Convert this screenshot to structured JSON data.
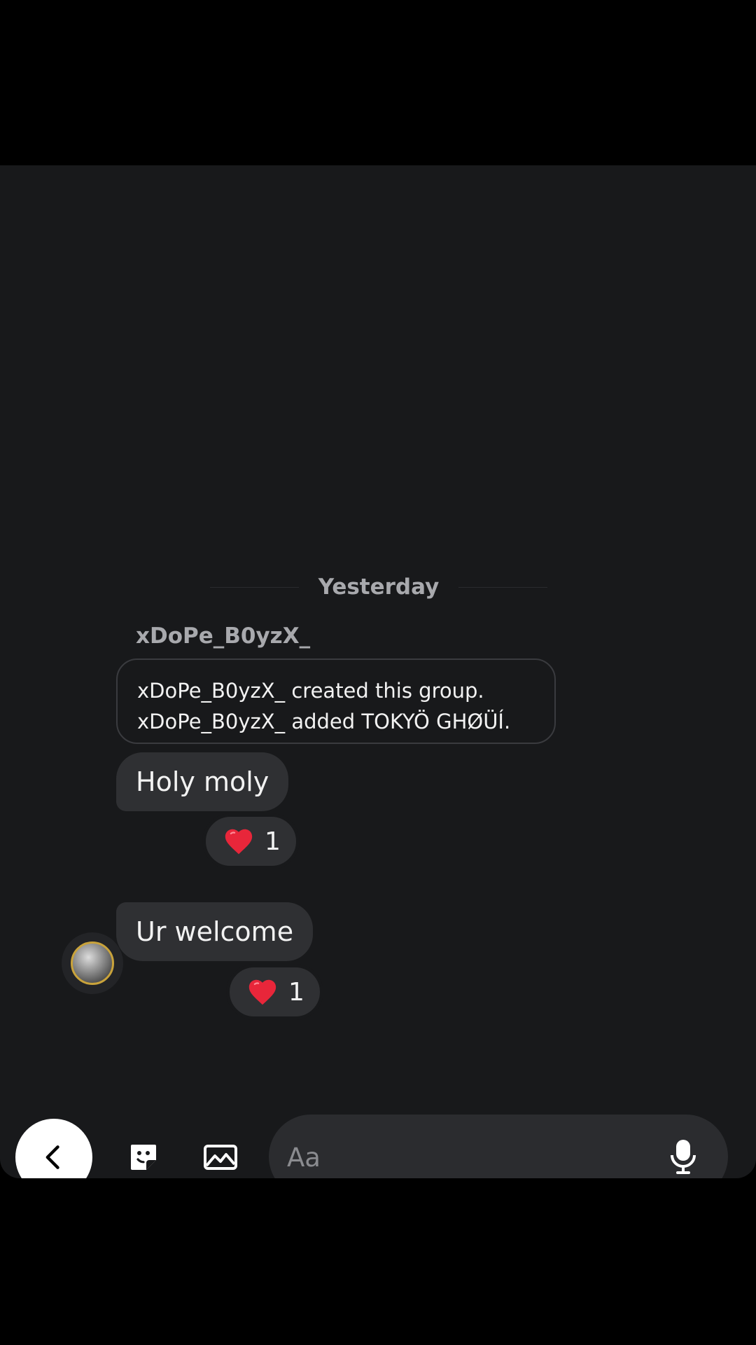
{
  "conversation": {
    "date_separator": "Yesterday",
    "sender_name": "xDoPe_B0yzX_",
    "system_messages": [
      "xDoPe_B0yzX_ created this group.",
      "xDoPe_B0yzX_ added TOKYÖ GHØÜÍ."
    ],
    "messages": [
      {
        "text": "Holy moly",
        "reaction_emoji": "heart",
        "reaction_count": "1"
      },
      {
        "text": "Ur welcome",
        "reaction_emoji": "heart",
        "reaction_count": "1"
      }
    ],
    "avatar_icon": "dragon-emblem-avatar"
  },
  "composer": {
    "placeholder": "Aa",
    "back_icon": "chevron-left-icon",
    "sticker_icon": "sticker-icon",
    "gallery_icon": "gallery-icon",
    "mic_icon": "microphone-icon"
  },
  "colors": {
    "background": "#18191b",
    "bubble": "#2f3033",
    "heart": "#e8263a",
    "text": "#f2f2f2",
    "muted": "#a8a9ad"
  }
}
